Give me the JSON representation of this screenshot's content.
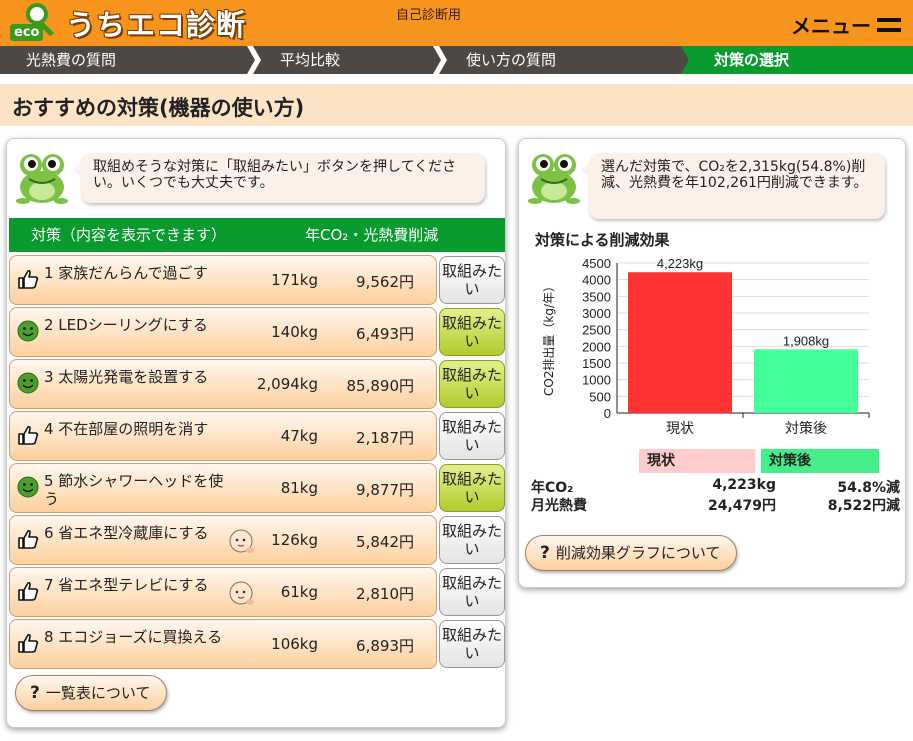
{
  "header": {
    "logo_badge": "eco",
    "app_title": "うちエコ診断",
    "subtitle": "自己診断用",
    "menu_label": "メニュー"
  },
  "steps": [
    {
      "label": "光熱費の質問",
      "active": false
    },
    {
      "label": "平均比較",
      "active": false
    },
    {
      "label": "使い方の質問",
      "active": false
    },
    {
      "label": "対策の選択",
      "active": true
    }
  ],
  "page_title": "おすすめの対策(機器の使い方)",
  "left_panel": {
    "message": "取組めそうな対策に「取組みたい」ボタンを押してください。いくつでも大丈夫です。",
    "table_header": {
      "measure": "対策（内容を表示できます）",
      "reduction": "年CO₂・光熱費削減"
    },
    "rows": [
      {
        "icon": "thumbs-up-icon",
        "label": "1 家族だんらんで過ごす",
        "co2": "171kg",
        "cost": "9,562円",
        "button": "取組みたい",
        "selected": false,
        "baby": false
      },
      {
        "icon": "smiley-icon",
        "label": "2 LEDシーリングにする",
        "co2": "140kg",
        "cost": "6,493円",
        "button": "取組みたい",
        "selected": true,
        "baby": false
      },
      {
        "icon": "smiley-icon",
        "label": "3 太陽光発電を設置する",
        "co2": "2,094kg",
        "cost": "85,890円",
        "button": "取組みたい",
        "selected": true,
        "baby": false
      },
      {
        "icon": "thumbs-up-icon",
        "label": "4 不在部屋の照明を消す",
        "co2": "47kg",
        "cost": "2,187円",
        "button": "取組みたい",
        "selected": false,
        "baby": false
      },
      {
        "icon": "smiley-icon",
        "label": "5 節水シャワーヘッドを使う",
        "co2": "81kg",
        "cost": "9,877円",
        "button": "取組みたい",
        "selected": true,
        "baby": false
      },
      {
        "icon": "thumbs-up-icon",
        "label": "6 省エネ型冷蔵庫にする",
        "co2": "126kg",
        "cost": "5,842円",
        "button": "取組みたい",
        "selected": false,
        "baby": true
      },
      {
        "icon": "thumbs-up-icon",
        "label": "7 省エネ型テレビにする",
        "co2": "61kg",
        "cost": "2,810円",
        "button": "取組みたい",
        "selected": false,
        "baby": true
      },
      {
        "icon": "thumbs-up-icon",
        "label": "8 エコジョーズに買換える",
        "co2": "106kg",
        "cost": "6,893円",
        "button": "取組みたい",
        "selected": false,
        "baby": false
      }
    ],
    "list_help": "一覧表について"
  },
  "right_panel": {
    "message": "選んだ対策で、CO₂を2,315kg(54.8%)削減、光熱費を年102,261円削減できます。",
    "chart_title": "対策による削減効果",
    "summary": {
      "col_current": "現状",
      "col_after": "対策後",
      "rows": [
        {
          "label": "年CO₂",
          "current": "4,223kg",
          "after": "54.8%減"
        },
        {
          "label": "月光熱費",
          "current": "24,479円",
          "after": "8,522円減"
        }
      ]
    },
    "graph_help": "削減効果グラフについて"
  },
  "colors": {
    "orange": "#f7941d",
    "green": "#0a9b2e",
    "bar_current": "#ff3333",
    "bar_after": "#44ff99",
    "head_current": "#ffcccc",
    "head_after": "#44ee88"
  },
  "chart_data": {
    "type": "bar",
    "categories": [
      "現状",
      "対策後"
    ],
    "values": [
      4223,
      1908
    ],
    "data_labels": [
      "4,223kg",
      "1,908kg"
    ],
    "ylabel": "CO2排出量（kg/年）",
    "ylim": [
      0,
      4500
    ],
    "yticks": [
      0,
      500,
      1000,
      1500,
      2000,
      2500,
      3000,
      3500,
      4000,
      4500
    ],
    "grid": true
  }
}
